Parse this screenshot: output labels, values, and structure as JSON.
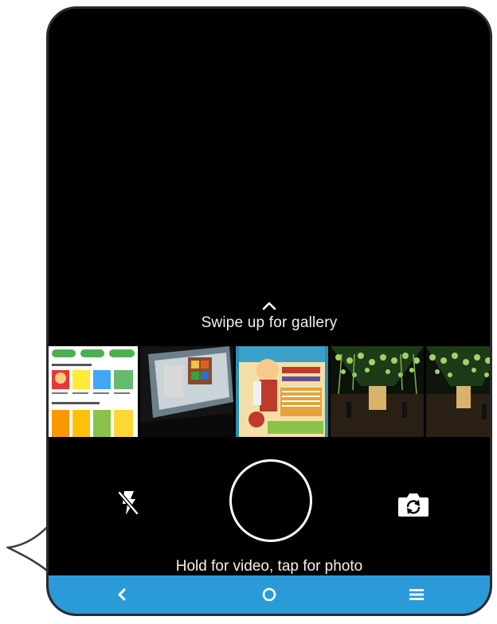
{
  "gallery_hint": {
    "icon": "chevron-up-icon",
    "text": "Swipe up for gallery"
  },
  "gallery_thumbnails": [
    {
      "name": "app-store-screenshot"
    },
    {
      "name": "monitor-photo"
    },
    {
      "name": "poster-photo"
    },
    {
      "name": "hall-decorations-photo"
    },
    {
      "name": "hall-decorations-photo-2"
    }
  ],
  "controls": {
    "flash_icon": "flash-off-icon",
    "shutter_icon": "shutter-icon",
    "switch_camera_icon": "switch-camera-icon"
  },
  "capture_hint": "Hold for video, tap for photo",
  "nav_bar": {
    "color": "#2a9bd8",
    "items": [
      "back-icon",
      "home-icon",
      "menu-icon"
    ]
  }
}
